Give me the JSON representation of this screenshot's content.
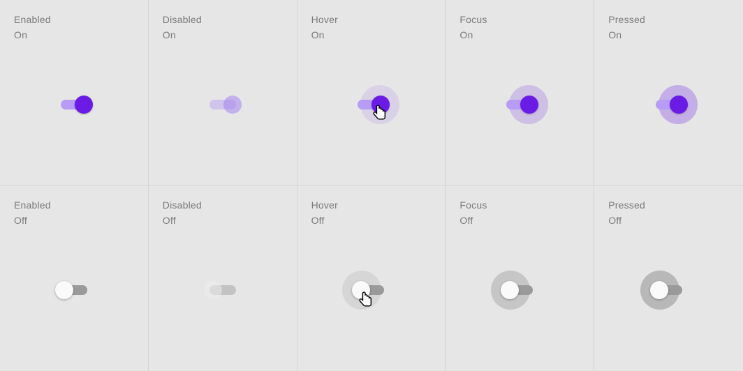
{
  "rows": [
    {
      "value": "On",
      "states": [
        {
          "state": "Enabled",
          "kind": "on",
          "halo": false,
          "disabled": false,
          "cursor": false
        },
        {
          "state": "Disabled",
          "kind": "on",
          "halo": false,
          "disabled": true,
          "cursor": false
        },
        {
          "state": "Hover",
          "kind": "on",
          "halo": true,
          "disabled": false,
          "cursor": true
        },
        {
          "state": "Focus",
          "kind": "on",
          "halo": true,
          "disabled": false,
          "cursor": false
        },
        {
          "state": "Pressed",
          "kind": "on",
          "halo": true,
          "disabled": false,
          "cursor": false
        }
      ]
    },
    {
      "value": "Off",
      "states": [
        {
          "state": "Enabled",
          "kind": "off",
          "halo": false,
          "disabled": false,
          "cursor": false
        },
        {
          "state": "Disabled",
          "kind": "off",
          "halo": false,
          "disabled": true,
          "cursor": false
        },
        {
          "state": "Hover",
          "kind": "off",
          "halo": true,
          "disabled": false,
          "cursor": true
        },
        {
          "state": "Focus",
          "kind": "off",
          "halo": true,
          "disabled": false,
          "cursor": false
        },
        {
          "state": "Pressed",
          "kind": "off",
          "halo": true,
          "disabled": false,
          "cursor": false
        }
      ]
    }
  ]
}
